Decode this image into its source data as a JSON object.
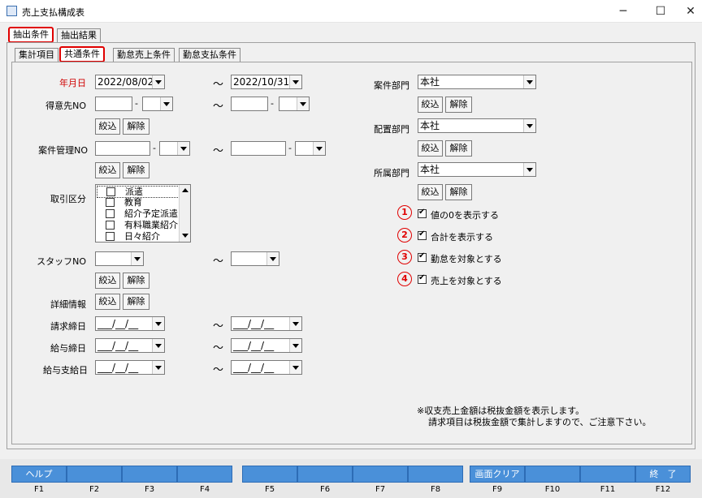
{
  "window": {
    "title": "売上支払構成表",
    "minimize": "─",
    "maximize": "☐",
    "close": "✕"
  },
  "top_tabs": [
    "抽出条件",
    "抽出結果"
  ],
  "sub_tabs": [
    "集計項目",
    "共通条件",
    "勤怠売上条件",
    "勤怠支払条件"
  ],
  "left": {
    "date_label": "年月日",
    "date_from": "2022/08/02",
    "date_to": "2022/10/31",
    "tokuisaki_label": "得意先NO",
    "anken_label": "案件管理NO",
    "torihiki_label": "取引区分",
    "torihiki_items": [
      "派遣",
      "教育",
      "紹介予定派遣",
      "有料職業紹介",
      "日々紹介"
    ],
    "staff_label": "スタッフNO",
    "shosai_label": "詳細情報",
    "seikyu_label": "請求締日",
    "kyuyo_label": "給与締日",
    "shikyu_label": "給与支給日",
    "date_blank": "___/__/__",
    "dash": "-",
    "tilde": "～"
  },
  "buttons": {
    "narrow": "絞込",
    "release": "解除"
  },
  "right": {
    "anken_bumon_label": "案件部門",
    "anken_bumon_value": "本社",
    "haichi_bumon_label": "配置部門",
    "haichi_bumon_value": "本社",
    "shozoku_bumon_label": "所属部門",
    "shozoku_bumon_value": "本社",
    "checks": [
      {
        "num": "1",
        "label": "値の0を表示する",
        "checked": true
      },
      {
        "num": "2",
        "label": "合計を表示する",
        "checked": true
      },
      {
        "num": "3",
        "label": "勤怠を対象とする",
        "checked": true
      },
      {
        "num": "4",
        "label": "売上を対象とする",
        "checked": true
      }
    ]
  },
  "notes": {
    "line1": "※収支売上金額は税抜金額を表示します。",
    "line2": "請求項目は税抜金額で集計しますので、ご注意下さい。"
  },
  "fkeys": [
    {
      "label": "ヘルプ",
      "num": "F1"
    },
    {
      "label": "",
      "num": "F2"
    },
    {
      "label": "",
      "num": "F3"
    },
    {
      "label": "",
      "num": "F4"
    },
    {
      "label": "",
      "num": "F5"
    },
    {
      "label": "",
      "num": "F6"
    },
    {
      "label": "",
      "num": "F7"
    },
    {
      "label": "",
      "num": "F8"
    },
    {
      "label": "画面クリア",
      "num": "F9"
    },
    {
      "label": "",
      "num": "F10"
    },
    {
      "label": "",
      "num": "F11"
    },
    {
      "label": "終　了",
      "num": "F12"
    }
  ]
}
